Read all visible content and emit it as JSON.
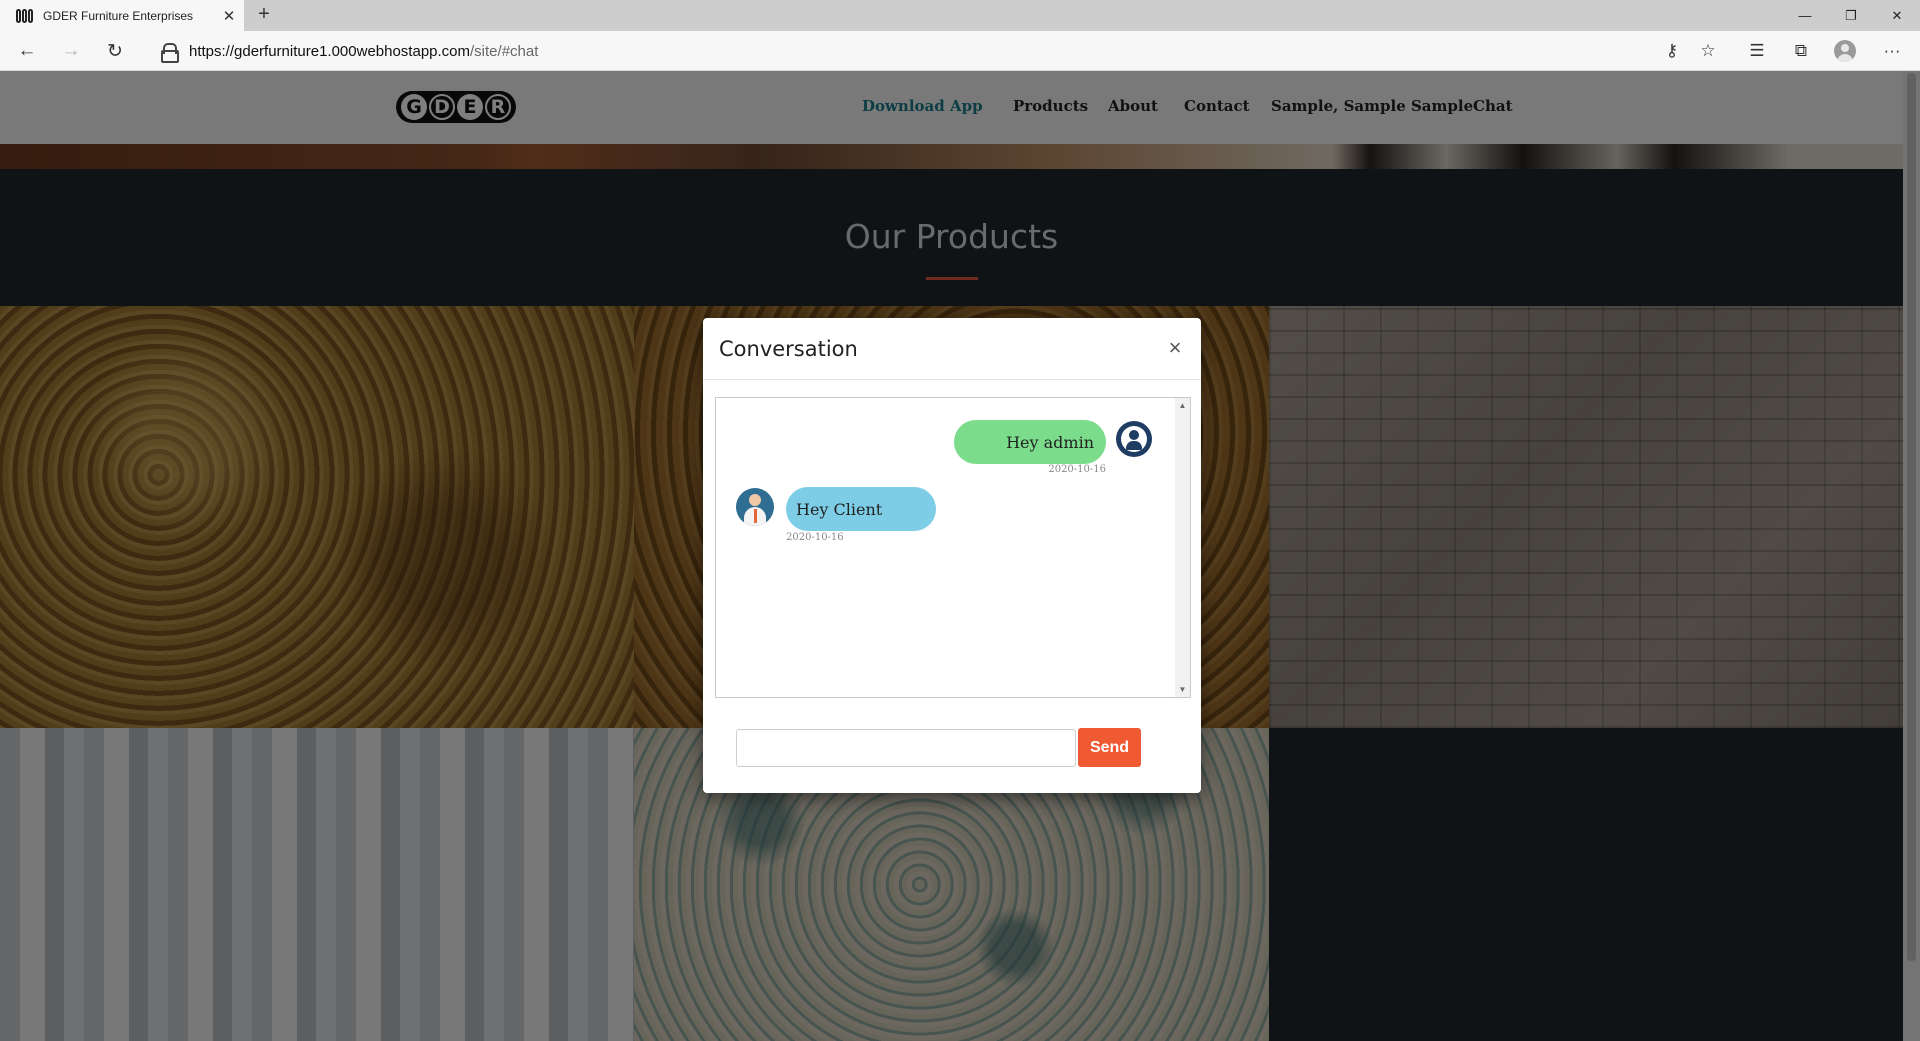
{
  "browser": {
    "tab_title": "GDER Furniture Enterprises",
    "tab_close": "✕",
    "new_tab": "+",
    "url_host": "https://gderfurniture1.000webhostapp.com",
    "url_path": "/site/#chat",
    "window": {
      "minimize": "—",
      "restore": "❐",
      "close": "✕"
    },
    "nav": {
      "back": "←",
      "forward": "→",
      "reload": "↻"
    },
    "tools": {
      "key": "⚷",
      "star": "☆",
      "favorites": "☰",
      "collections": "⧉",
      "more": "···"
    }
  },
  "site": {
    "logo_letters": [
      "G",
      "D",
      "E",
      "R"
    ],
    "nav": [
      "Download App",
      "Products",
      "About",
      "Contact",
      "Sample, Sample Sample",
      "Chat"
    ],
    "nav_active": "Download App",
    "section_title": "Our Products",
    "accent_color": "#e0563a"
  },
  "modal": {
    "title": "Conversation",
    "close": "×",
    "messages": [
      {
        "from": "admin",
        "text": "Hey admin",
        "date": "2020-10-16",
        "color": "#7bdc8c"
      },
      {
        "from": "client",
        "text": "Hey Client",
        "date": "2020-10-16",
        "color": "#7dcde6"
      }
    ],
    "input_value": "",
    "send_label": "Send",
    "send_color": "#f05a32"
  }
}
